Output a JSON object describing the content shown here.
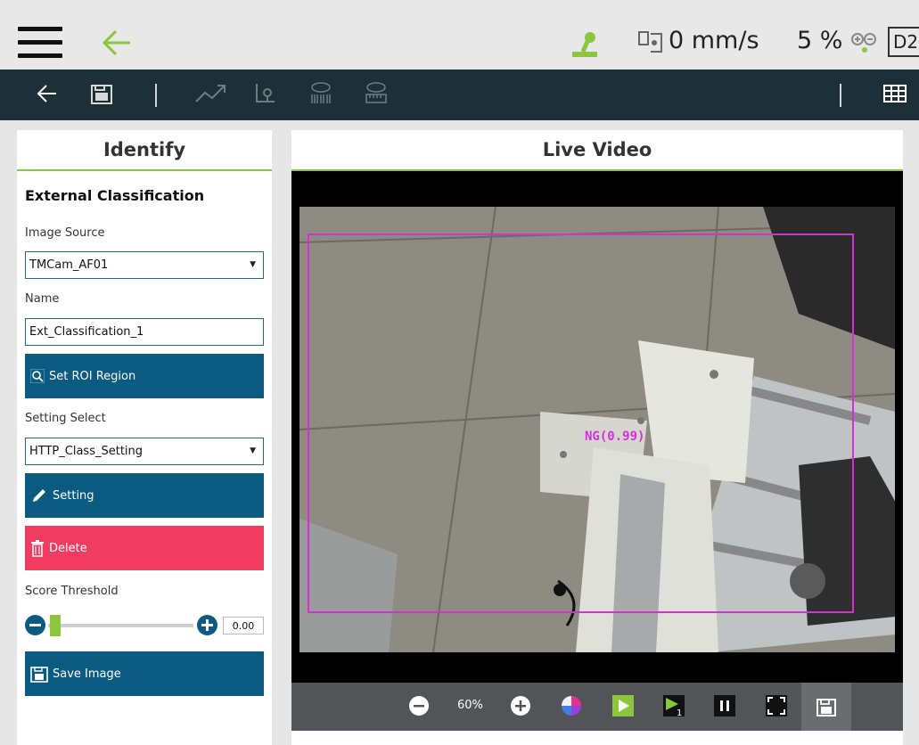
{
  "header": {
    "speed": "0 mm/s",
    "percent": "5 %",
    "mode": "D2",
    "accent_color": "#8cc63f"
  },
  "toolbar": {
    "icons": [
      "back-arrow-icon",
      "save-project-icon",
      "trend-icon",
      "locate-icon",
      "barcode-icon",
      "measure-icon",
      "grid-table-icon"
    ]
  },
  "identify": {
    "title": "Identify",
    "section_title": "External Classification",
    "image_source_label": "Image Source",
    "image_source_value": "TMCam_AF01",
    "name_label": "Name",
    "name_value": "Ext_Classification_1",
    "roi_button": "Set ROI Region",
    "setting_select_label": "Setting Select",
    "setting_select_value": "HTTP_Class_Setting",
    "setting_button": "Setting",
    "delete_button": "Delete",
    "score_threshold_label": "Score Threshold",
    "score_threshold_value": "0.00",
    "save_image_button": "Save Image"
  },
  "live_video": {
    "title": "Live Video",
    "detection_label": "NG(0.99)",
    "detection_color": "#d62fd6",
    "zoom": "60%"
  }
}
